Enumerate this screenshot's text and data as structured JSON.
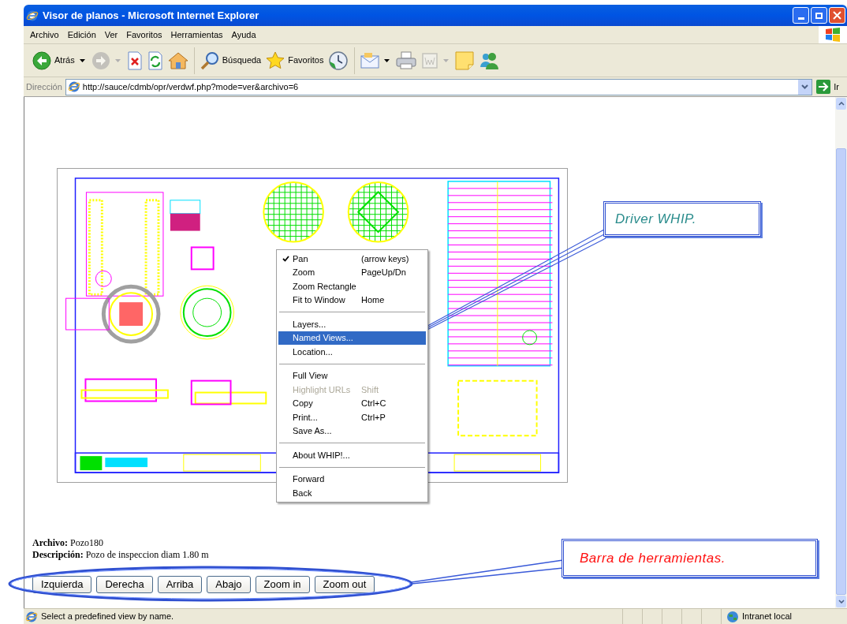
{
  "window": {
    "title": "Visor de planos - Microsoft Internet Explorer"
  },
  "menu_bar": [
    "Archivo",
    "Edición",
    "Ver",
    "Favoritos",
    "Herramientas",
    "Ayuda"
  ],
  "toolbar": [
    {
      "kind": "back",
      "label": "Atrás",
      "disabled": false,
      "dropdown": true
    },
    {
      "kind": "forward",
      "disabled": true,
      "dropdown": true
    },
    {
      "kind": "stop",
      "disabled": false,
      "dropdown": false
    },
    {
      "kind": "refresh",
      "disabled": false,
      "dropdown": false
    },
    {
      "kind": "home",
      "disabled": false,
      "dropdown": false
    },
    {
      "kind": "separator"
    },
    {
      "kind": "search",
      "label": "Búsqueda",
      "disabled": false,
      "dropdown": false
    },
    {
      "kind": "favorites",
      "label": "Favoritos",
      "disabled": false,
      "dropdown": false
    },
    {
      "kind": "history",
      "disabled": false,
      "dropdown": false
    },
    {
      "kind": "separator"
    },
    {
      "kind": "mail",
      "disabled": false,
      "dropdown": true
    },
    {
      "kind": "print",
      "disabled": false,
      "dropdown": false
    },
    {
      "kind": "edit",
      "disabled": true,
      "dropdown": true
    },
    {
      "kind": "note",
      "disabled": false,
      "dropdown": false
    },
    {
      "kind": "messenger",
      "disabled": false,
      "dropdown": false
    }
  ],
  "address_bar": {
    "label": "Dirección",
    "url": "http://sauce/cdmb/opr/verdwf.php?mode=ver&archivo=6",
    "go_label": "Ir"
  },
  "context_menu": [
    {
      "kind": "item",
      "label": "Pan",
      "shortcut": "(arrow keys)",
      "checked": true,
      "disabled": false,
      "selected": false
    },
    {
      "kind": "item",
      "label": "Zoom",
      "shortcut": "PageUp/Dn",
      "checked": false,
      "disabled": false,
      "selected": false
    },
    {
      "kind": "item",
      "label": "Zoom Rectangle",
      "checked": false,
      "disabled": false,
      "selected": false
    },
    {
      "kind": "item",
      "label": "Fit to Window",
      "shortcut": "Home",
      "checked": false,
      "disabled": false,
      "selected": false
    },
    {
      "kind": "separator"
    },
    {
      "kind": "item",
      "label": "Layers...",
      "checked": false,
      "disabled": false,
      "selected": false
    },
    {
      "kind": "item",
      "label": "Named Views...",
      "checked": false,
      "disabled": false,
      "selected": true
    },
    {
      "kind": "item",
      "label": "Location...",
      "checked": false,
      "disabled": false,
      "selected": false
    },
    {
      "kind": "separator"
    },
    {
      "kind": "item",
      "label": "Full View",
      "checked": false,
      "disabled": false,
      "selected": false
    },
    {
      "kind": "item",
      "label": "Highlight URLs",
      "shortcut": "Shift",
      "checked": false,
      "disabled": true,
      "selected": false
    },
    {
      "kind": "item",
      "label": "Copy",
      "shortcut": "Ctrl+C",
      "checked": false,
      "disabled": false,
      "selected": false
    },
    {
      "kind": "item",
      "label": "Print...",
      "shortcut": "Ctrl+P",
      "checked": false,
      "disabled": false,
      "selected": false
    },
    {
      "kind": "item",
      "label": "Save As...",
      "checked": false,
      "disabled": false,
      "selected": false
    },
    {
      "kind": "separator"
    },
    {
      "kind": "item",
      "label": "About WHIP!...",
      "checked": false,
      "disabled": false,
      "selected": false
    },
    {
      "kind": "separator"
    },
    {
      "kind": "item",
      "label": "Forward",
      "checked": false,
      "disabled": false,
      "selected": false
    },
    {
      "kind": "item",
      "label": "Back",
      "checked": false,
      "disabled": false,
      "selected": false
    }
  ],
  "file_info": [
    {
      "label": "Archivo:",
      "value": "Pozo180"
    },
    {
      "label": "Descripción:",
      "value": "Pozo de inspeccion diam 1.80 m"
    }
  ],
  "nav_buttons": [
    "Izquierda",
    "Derecha",
    "Arriba",
    "Abajo",
    "Zoom in",
    "Zoom out"
  ],
  "callouts": [
    {
      "text": "Driver WHIP.",
      "color": "#2a8c8c"
    },
    {
      "text": "Barra de herramientas.",
      "color": "#ff1010"
    }
  ],
  "status_bar": {
    "text": "Select a predefined view by name.",
    "zone": "Intranet local"
  }
}
